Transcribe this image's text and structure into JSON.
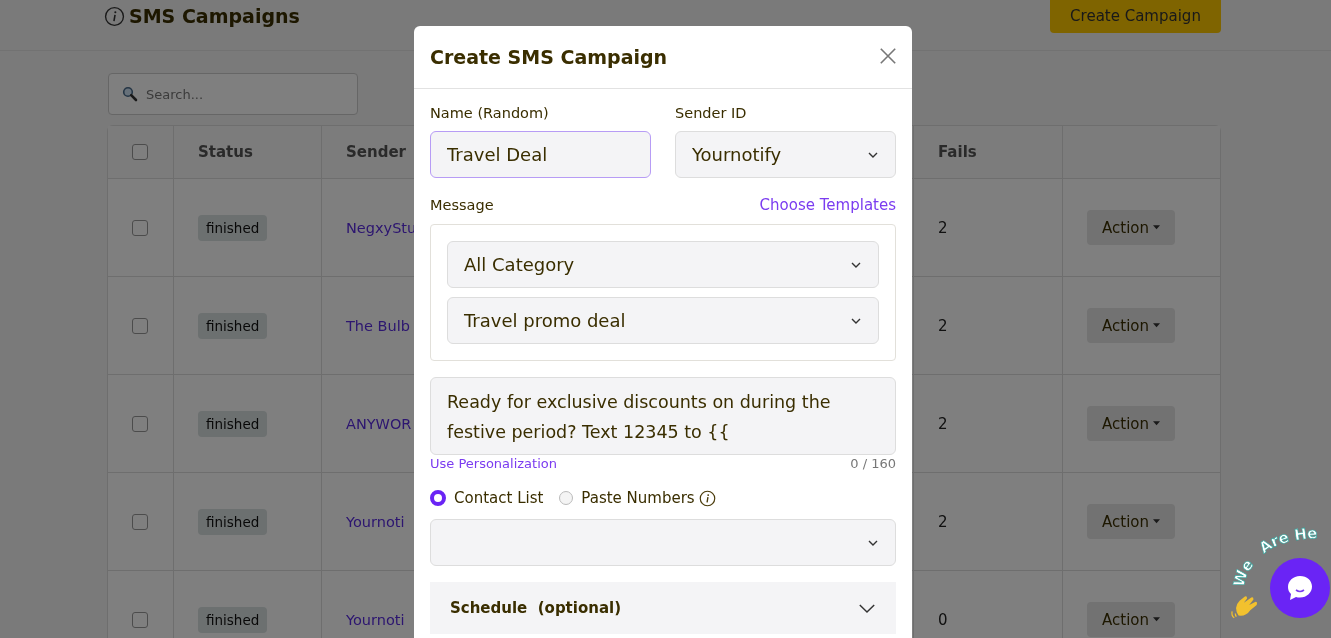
{
  "page": {
    "title": "SMS Campaigns",
    "create_button": "Create Campaign",
    "search": {
      "placeholder": "Search..."
    }
  },
  "table": {
    "header_checked": false,
    "columns": [
      "Status",
      "Sender",
      "Fails"
    ],
    "rows": [
      {
        "checked": false,
        "status": "finished",
        "sender": "NegxyStu",
        "fails": "2",
        "action": "Action"
      },
      {
        "checked": false,
        "status": "finished",
        "sender": "The Bulb",
        "fails": "2",
        "action": "Action"
      },
      {
        "checked": false,
        "status": "finished",
        "sender": "ANYWOR",
        "fails": "2",
        "action": "Action"
      },
      {
        "checked": false,
        "status": "finished",
        "sender": "Yournoti",
        "fails": "2",
        "action": "Action"
      },
      {
        "checked": false,
        "status": "finished",
        "sender": "Yournoti",
        "fails": "0",
        "action": "Action"
      }
    ]
  },
  "modal": {
    "title": "Create SMS Campaign",
    "name": {
      "label": "Name (Random)",
      "value": "Travel Deal"
    },
    "sender_id": {
      "label": "Sender ID",
      "value": "Yournotify"
    },
    "message": {
      "label": "Message",
      "templates_link": "Choose Templates",
      "category": "All Category",
      "template": "Travel promo deal",
      "text": "Ready for exclusive discounts on during the festive period? Text 12345 to {{",
      "personalization_link": "Use Personalization",
      "counter": "0 / 160"
    },
    "recipients": [
      {
        "label": "Contact List",
        "selected": true
      },
      {
        "label": "Paste Numbers",
        "selected": false
      }
    ],
    "schedule": {
      "title": "Schedule  (optional)"
    }
  },
  "chat": {
    "banner": [
      "We",
      "Are He"
    ]
  }
}
